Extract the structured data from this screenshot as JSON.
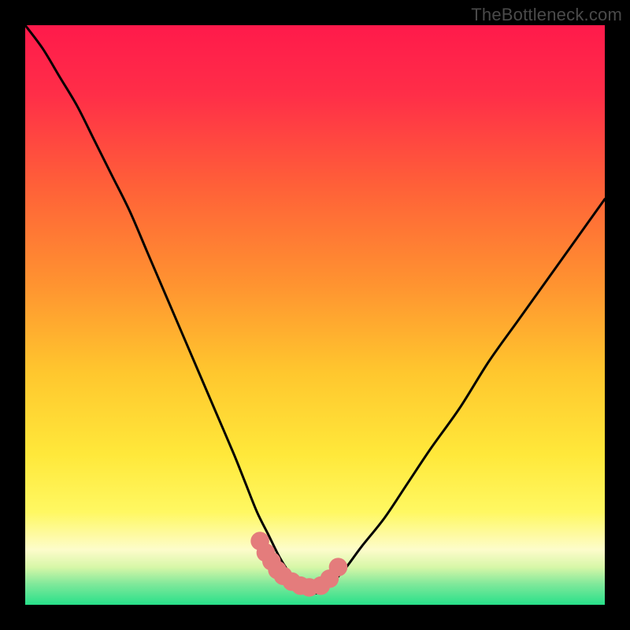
{
  "watermark": "TheBottleneck.com",
  "colors": {
    "gradient_stops": [
      {
        "offset": 0.0,
        "color": "#ff1a4b"
      },
      {
        "offset": 0.12,
        "color": "#ff2e48"
      },
      {
        "offset": 0.28,
        "color": "#ff6138"
      },
      {
        "offset": 0.45,
        "color": "#ff9430"
      },
      {
        "offset": 0.6,
        "color": "#ffc72e"
      },
      {
        "offset": 0.74,
        "color": "#ffe83a"
      },
      {
        "offset": 0.84,
        "color": "#fff862"
      },
      {
        "offset": 0.905,
        "color": "#fdfccb"
      },
      {
        "offset": 0.935,
        "color": "#d7f7a8"
      },
      {
        "offset": 0.965,
        "color": "#7ee89a"
      },
      {
        "offset": 1.0,
        "color": "#28e08a"
      }
    ],
    "curve": "#000000",
    "dots": "#e47c7c",
    "frame": "#000000"
  },
  "chart_data": {
    "type": "line",
    "title": "",
    "xlabel": "",
    "ylabel": "",
    "xlim": [
      0,
      100
    ],
    "ylim": [
      0,
      100
    ],
    "grid": false,
    "legend": false,
    "series": [
      {
        "name": "bottleneck-curve",
        "x": [
          0,
          3,
          6,
          9,
          12,
          15,
          18,
          21,
          24,
          27,
          30,
          33,
          36,
          38,
          40,
          42,
          44,
          46,
          48,
          50,
          52,
          55,
          58,
          62,
          66,
          70,
          75,
          80,
          85,
          90,
          95,
          100
        ],
        "y": [
          100,
          96,
          91,
          86,
          80,
          74,
          68,
          61,
          54,
          47,
          40,
          33,
          26,
          21,
          16,
          12,
          8,
          5,
          3,
          2,
          3,
          6,
          10,
          15,
          21,
          27,
          34,
          42,
          49,
          56,
          63,
          70
        ]
      }
    ],
    "highlight_dots": {
      "name": "optimal-zone-dots",
      "x": [
        40.5,
        41.5,
        42.5,
        43.5,
        44.5,
        46,
        47.5,
        49,
        51,
        52.5,
        54
      ],
      "y": [
        11.0,
        9.0,
        7.5,
        6.0,
        5.0,
        4.0,
        3.3,
        3.0,
        3.3,
        4.5,
        6.5
      ],
      "radius_pct": 1.6
    }
  }
}
